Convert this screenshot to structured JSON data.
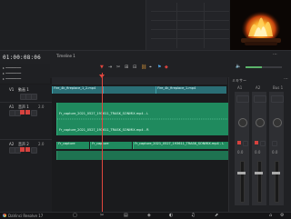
{
  "viewer": {
    "timecode": "01:00:08:06"
  },
  "inspector": {
    "rows": [
      "",
      "",
      "",
      "",
      ""
    ]
  },
  "timeline": {
    "name": "Timeline 1",
    "tracks": {
      "v1": {
        "id": "V1",
        "name": "動画 1"
      },
      "a1": {
        "id": "A1",
        "name": "音声 1",
        "level": "2.0"
      },
      "a2": {
        "id": "A2",
        "name": "音声 2",
        "level": "2.0"
      }
    },
    "clips": {
      "video_main": "Fire_4k_fireplace_1_2.mp4",
      "video_right": "Fire_4k_fireplace_1.mp4",
      "audio_a1_top": "Fr_capture_2021_0527_193611_TRASK_SONMIX.mp4 - L",
      "audio_a1_bottom": "Fr_capture_2021_0527_193611_TRASK_SONMIX.mp4 - R",
      "audio_a2_left": "Fr_capture",
      "audio_a2_mid": "Fr_capture",
      "audio_a2_right": "Fr_capture_2021_0527_193611_TRASK_SONMIX.mp4 - L"
    }
  },
  "mixer": {
    "title": "ミキサー",
    "channels": [
      "A1",
      "A2",
      "Bus 1"
    ],
    "values": [
      "0.0",
      "0.0",
      "0.0"
    ]
  },
  "statusbar": {
    "app_name": "DaVinci Resolve 17"
  },
  "colors": {
    "playhead": "#e0463e",
    "video_clip": "#2a6e75",
    "audio_clip": "#1f8a5e",
    "accent_red": "#d6423e"
  }
}
